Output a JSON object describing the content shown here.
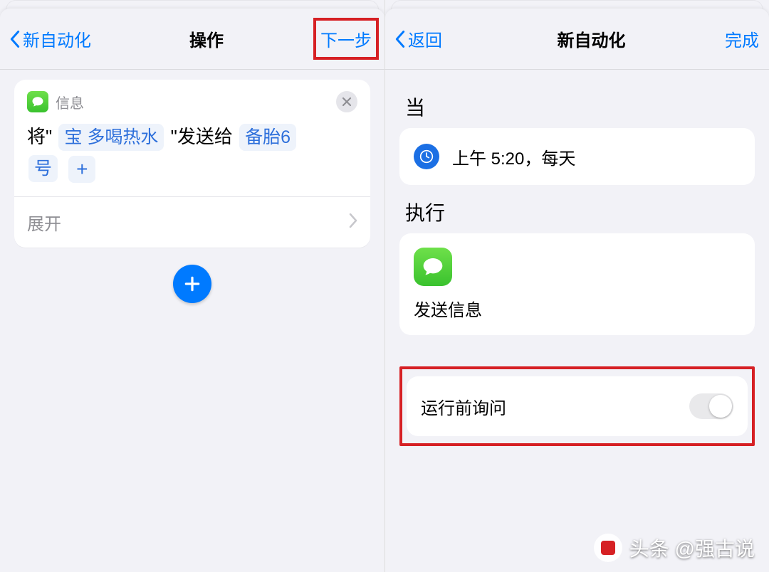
{
  "left": {
    "nav": {
      "back": "新自动化",
      "title": "操作",
      "next": "下一步"
    },
    "card": {
      "app": "信息",
      "prefix": "将\"",
      "msg_token": "宝 多喝热水",
      "mid": "\"发送给",
      "recipient_1": "备胎6",
      "recipient_2": "号",
      "expand": "展开"
    }
  },
  "right": {
    "nav": {
      "back": "返回",
      "title": "新自动化",
      "done": "完成"
    },
    "when": {
      "label": "当",
      "time": "上午 5:20，每天"
    },
    "do": {
      "label": "执行",
      "action": "发送信息"
    },
    "toggle": {
      "label": "运行前询问"
    }
  },
  "watermark": "头条 @强古说"
}
